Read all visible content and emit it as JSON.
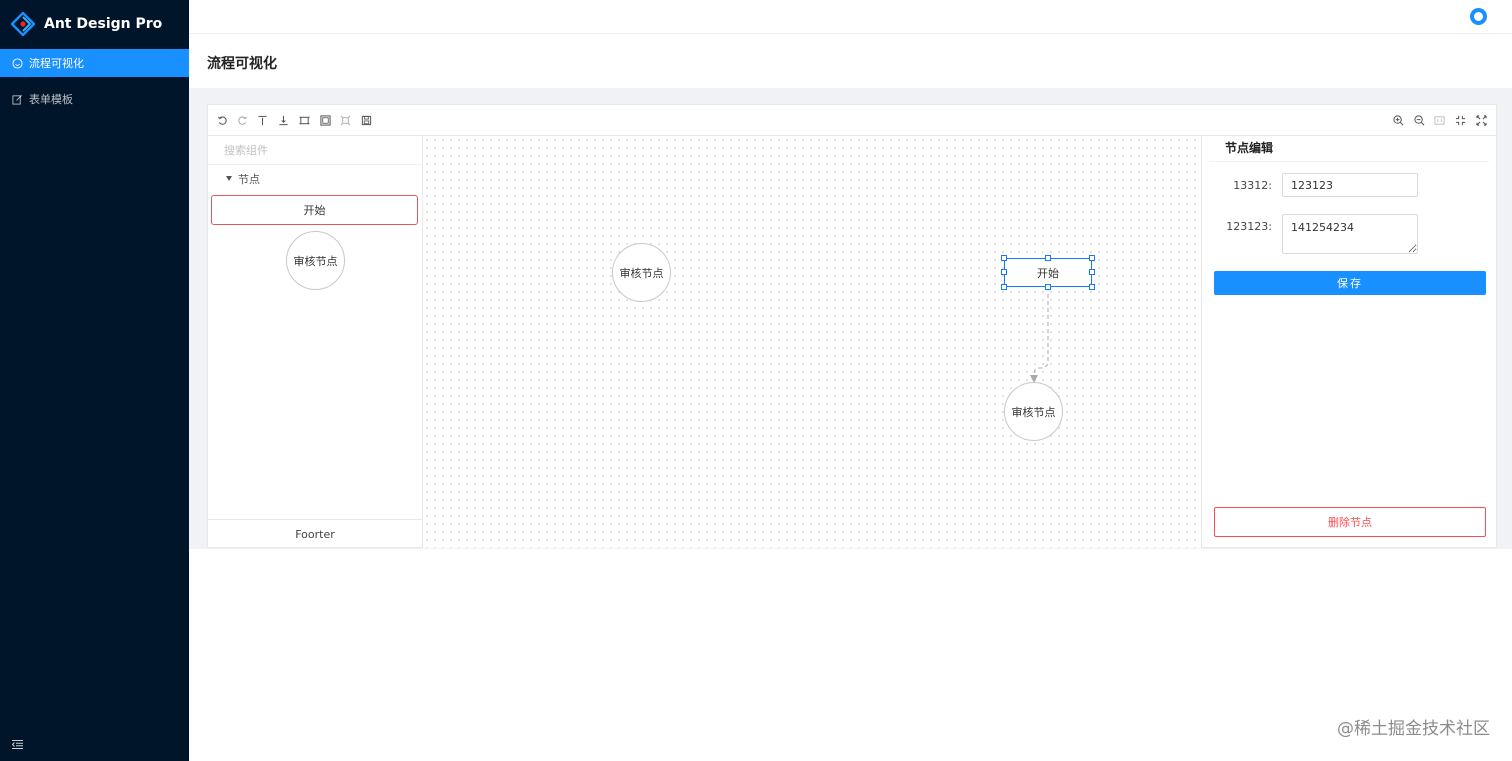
{
  "app": {
    "logo_text": "Ant Design Pro"
  },
  "sidebar": {
    "items": [
      {
        "label": "流程可视化",
        "icon": "smile-icon",
        "active": true
      },
      {
        "label": "表单模板",
        "icon": "edit-icon",
        "active": false
      }
    ]
  },
  "page": {
    "title": "流程可视化"
  },
  "palette": {
    "search_placeholder": "搜索组件",
    "group_label": "节点",
    "start_node_label": "开始",
    "audit_node_label": "审核节点",
    "footer": "Foorter"
  },
  "canvas": {
    "nodes": [
      {
        "label": "审核节点",
        "shape": "circle"
      },
      {
        "label": "开始",
        "shape": "rect",
        "selected": true
      },
      {
        "label": "审核节点",
        "shape": "circle"
      }
    ]
  },
  "editor_panel": {
    "title": "节点编辑",
    "fields": [
      {
        "label": "13312:",
        "value": "123123"
      },
      {
        "label": "123123:",
        "value": "141254234"
      }
    ],
    "save_label": "保存",
    "delete_label": "删除节点"
  },
  "watermark": "@稀土掘金技术社区",
  "colors": {
    "primary": "#1890ff",
    "sider_bg": "#001529",
    "danger": "#ff4d4f"
  }
}
